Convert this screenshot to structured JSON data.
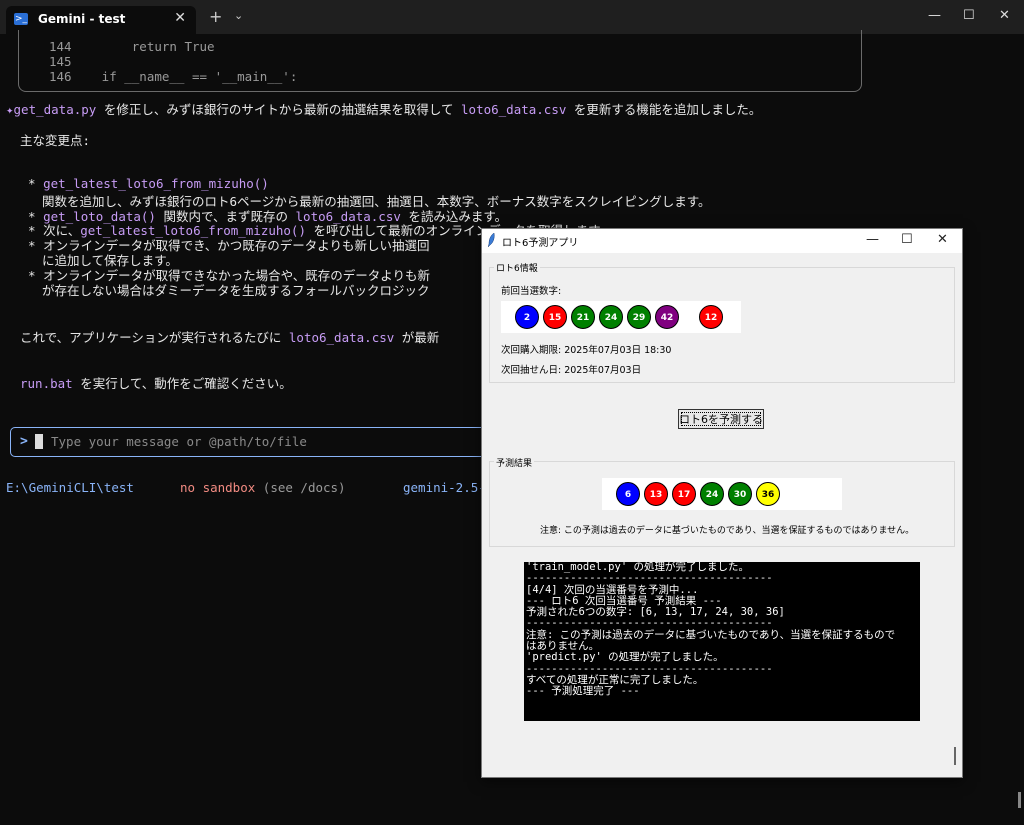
{
  "terminal": {
    "tab_title": "Gemini - test",
    "tab_close": "✕",
    "new_tab": "+",
    "tab_dropdown": "⌄",
    "window_minimize": "—",
    "window_maximize": "☐",
    "window_close": "✕",
    "code_lines": [
      {
        "num": "144",
        "code": "        return True"
      },
      {
        "num": "145",
        "code": ""
      },
      {
        "num": "146",
        "code": "    if __name__ == '__main__':"
      }
    ],
    "summary_star": "✦",
    "summary_file1": "get_data.py",
    "summary_text1": " を修正し、みずほ銀行のサイトから最新の抽選結果を取得して ",
    "summary_file2": "loto6_data.csv",
    "summary_text2": " を更新する機能を追加しました。",
    "changes_heading": "主な変更点:",
    "bullet1_func": "get_latest_loto6_from_mizuho()",
    "bullet1_desc": "関数を追加し、みずほ銀行のロト6ページから最新の抽選回、抽選日、本数字、ボーナス数字をスクレイピングします。",
    "bullet2_func": "get_loto_data()",
    "bullet2_text1": " 関数内で、まず既存の ",
    "bullet2_file": "loto6_data.csv",
    "bullet2_text2": " を読み込みます。",
    "bullet3_text1": "次に、",
    "bullet3_func": "get_latest_loto6_from_mizuho()",
    "bullet3_text2": " を呼び出して最新のオンラインデータを取得します。",
    "bullet4_line1": "オンラインデータが取得でき、かつ既存のデータよりも新しい抽選回",
    "bullet4_line2": "に追加して保存します。",
    "bullet5_line1": "オンラインデータが取得できなかった場合や、既存のデータよりも新",
    "bullet5_line2": "が存在しない場合はダミーデータを生成するフォールバックロジック",
    "conclusion_text1": "これで、アプリケーションが実行されるたびに ",
    "conclusion_file": "loto6_data.csv",
    "conclusion_text2": " が最新",
    "run_file": "run.bat",
    "run_text": " を実行して、動作をご確認ください。",
    "input_prompt": ">",
    "input_placeholder": "Type your message or @path/to/file",
    "status_path": "E:\\GeminiCLI\\test",
    "status_sandbox": "no sandbox",
    "status_docs": " (see /docs)",
    "status_model": "gemini-2.5-"
  },
  "app": {
    "title": "ロト6予測アプリ",
    "minimize": "—",
    "maximize": "☐",
    "close": "✕",
    "info_group_label": "ロト6情報",
    "last_numbers_label": "前回当選数字:",
    "last_numbers": [
      {
        "n": "2",
        "color": "#0000ff"
      },
      {
        "n": "15",
        "color": "#ff0000"
      },
      {
        "n": "21",
        "color": "#008000"
      },
      {
        "n": "24",
        "color": "#008000"
      },
      {
        "n": "29",
        "color": "#008000"
      },
      {
        "n": "42",
        "color": "#800080"
      }
    ],
    "bonus_number": {
      "n": "12",
      "color": "#ff0000"
    },
    "purchase_deadline": "次回購入期限: 2025年07月03日 18:30",
    "draw_date": "次回抽せん日: 2025年07月03日",
    "predict_button": "ロト6を予測する",
    "result_group_label": "予測結果",
    "predicted_numbers": [
      {
        "n": "6",
        "color": "#0000ff"
      },
      {
        "n": "13",
        "color": "#ff0000"
      },
      {
        "n": "17",
        "color": "#ff0000"
      },
      {
        "n": "24",
        "color": "#008000"
      },
      {
        "n": "30",
        "color": "#008000"
      },
      {
        "n": "36",
        "color": "#ffff00"
      }
    ],
    "disclaimer": "注意: この予測は過去のデータに基づいたものであり、当選を保証するものではありません。",
    "console_lines": [
      "'train_model.py' の処理が完了しました。",
      "---------------------------------------",
      "",
      "[4/4] 次回の当選番号を予測中...",
      "--- ロト6 次回当選番号 予測結果 ---",
      "予測された6つの数字: [6, 13, 17, 24, 30, 36]",
      "---------------------------------------",
      "",
      "注意: この予測は過去のデータに基づいたものであり、当選を保証するもので",
      "はありません。",
      "'predict.py' の処理が完了しました。",
      "---------------------------------------",
      "",
      "すべての処理が正常に完了しました。",
      "--- 予測処理完了 ---"
    ]
  }
}
